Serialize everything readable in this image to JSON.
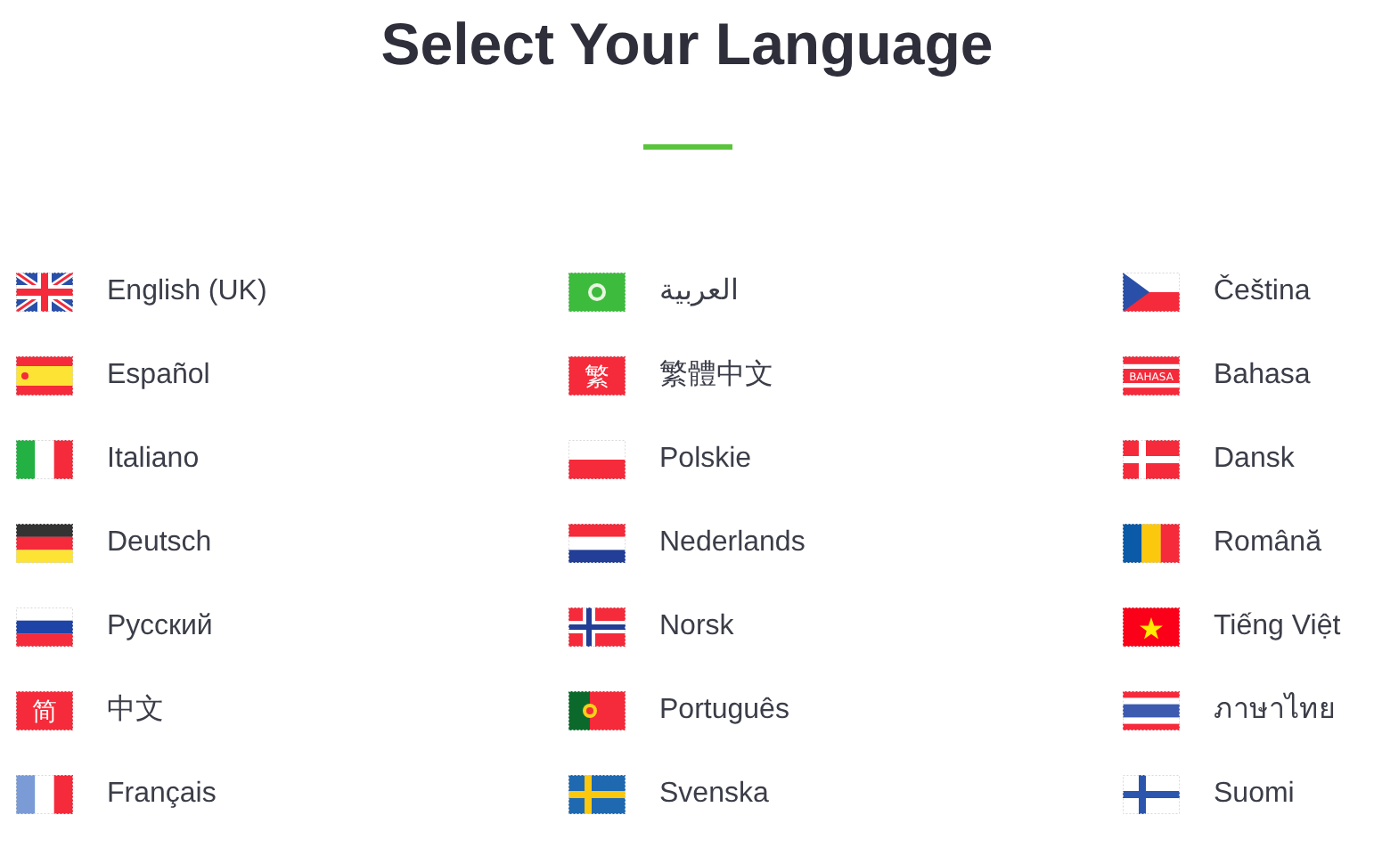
{
  "title": "Select Your Language",
  "columns": [
    [
      {
        "label": "English (UK)",
        "kind": "uk"
      },
      {
        "label": "Español",
        "kind": "es"
      },
      {
        "label": "Italiano",
        "kind": "it"
      },
      {
        "label": "Deutsch",
        "kind": "de"
      },
      {
        "label": "Русский",
        "kind": "ru"
      },
      {
        "label": "中文",
        "kind": "cn_simplified",
        "flag_text": "简"
      },
      {
        "label": "Français",
        "kind": "fr"
      }
    ],
    [
      {
        "label": "العربية",
        "kind": "arab"
      },
      {
        "label": "繁體中文",
        "kind": "cn_traditional",
        "flag_text": "繁"
      },
      {
        "label": "Polskie",
        "kind": "pl"
      },
      {
        "label": "Nederlands",
        "kind": "nl"
      },
      {
        "label": "Norsk",
        "kind": "no"
      },
      {
        "label": "Português",
        "kind": "pt"
      },
      {
        "label": "Svenska",
        "kind": "se"
      }
    ],
    [
      {
        "label": "Čeština",
        "kind": "cz"
      },
      {
        "label": "Bahasa",
        "kind": "bahasa",
        "flag_text": "BAHASA"
      },
      {
        "label": "Dansk",
        "kind": "dk"
      },
      {
        "label": "Română",
        "kind": "ro"
      },
      {
        "label": "Tiếng Việt",
        "kind": "vn"
      },
      {
        "label": "ภาษาไทย",
        "kind": "th"
      },
      {
        "label": "Suomi",
        "kind": "fi"
      }
    ]
  ]
}
